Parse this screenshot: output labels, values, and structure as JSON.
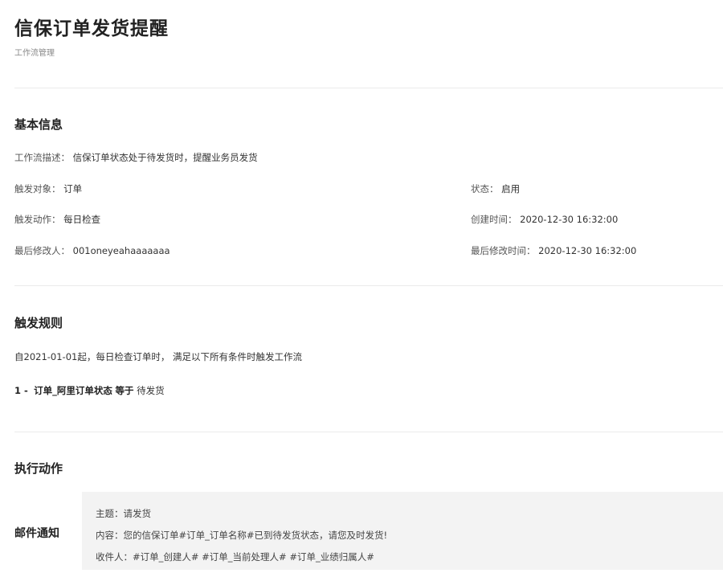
{
  "header": {
    "title": "信保订单发货提醒",
    "subtitle": "工作流管理"
  },
  "basic_info": {
    "section_title": "基本信息",
    "description_label": "工作流描述：",
    "description_value": "信保订单状态处于待发货时，提醒业务员发货",
    "trigger_object_label": "触发对象：",
    "trigger_object_value": "订单",
    "status_label": "状态：",
    "status_value": "启用",
    "trigger_action_label": "触发动作：",
    "trigger_action_value": "每日检查",
    "created_time_label": "创建时间：",
    "created_time_value": "2020-12-30 16:32:00",
    "last_modifier_label": "最后修改人：",
    "last_modifier_value": "001oneyeahaaaaaaa",
    "last_modified_time_label": "最后修改时间：",
    "last_modified_time_value": "2020-12-30 16:32:00"
  },
  "trigger_rules": {
    "section_title": "触发规则",
    "summary": "自2021-01-01起，每日检查订单时，  满足以下所有条件时触发工作流",
    "rules": [
      {
        "index": "1 -",
        "field": "订单_阿里订单状态",
        "operator": "等于",
        "value": "待发货"
      }
    ]
  },
  "actions": {
    "section_title": "执行动作",
    "email": {
      "label": "邮件通知",
      "subject": "主题：请发货",
      "content": "内容：您的信保订单#订单_订单名称#已到待发货状态，请您及时发货!",
      "recipients": "收件人：#订单_创建人# #订单_当前处理人# #订单_业绩归属人#"
    }
  }
}
